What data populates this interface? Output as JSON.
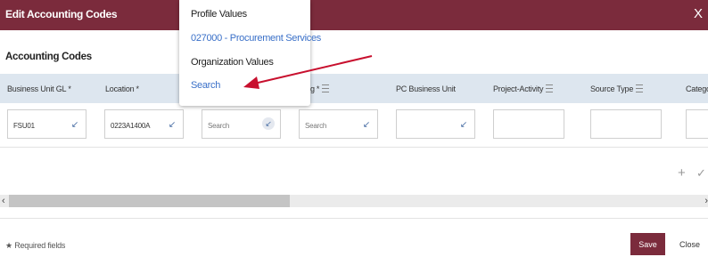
{
  "dialog": {
    "title": "Edit Accounting Codes",
    "close_glyph": "X"
  },
  "section_title": "Accounting Codes",
  "columns": [
    {
      "label": "Business Unit GL",
      "required": "*"
    },
    {
      "label": "Location",
      "required": "*"
    },
    {
      "label": "g",
      "required": "*"
    },
    {
      "label": "PC Business Unit"
    },
    {
      "label": "Project-Activity"
    },
    {
      "label": "Source Type"
    },
    {
      "label": "Catego"
    }
  ],
  "row": {
    "business_unit_gl": "FSU01",
    "location": "0223A1400A",
    "search_placeholder_1": "Search",
    "search_placeholder_2": "Search",
    "lookup_glyph": "↙"
  },
  "row_actions": {
    "add": "+",
    "confirm": "✓"
  },
  "scroll": {
    "left": "‹",
    "right": "›"
  },
  "footer": {
    "required_note": "Required fields",
    "required_star": "★",
    "save": "Save",
    "close": "Close"
  },
  "popup": {
    "items": [
      {
        "label": "Profile Values"
      },
      {
        "label": "027000 - Procurement Services"
      },
      {
        "label": "Organization Values"
      },
      {
        "label": "Search"
      }
    ]
  },
  "colors": {
    "brand": "#7b2b3c",
    "link": "#3a70c8",
    "header_bg": "#dde6ef",
    "arrow": "#c8102e"
  }
}
